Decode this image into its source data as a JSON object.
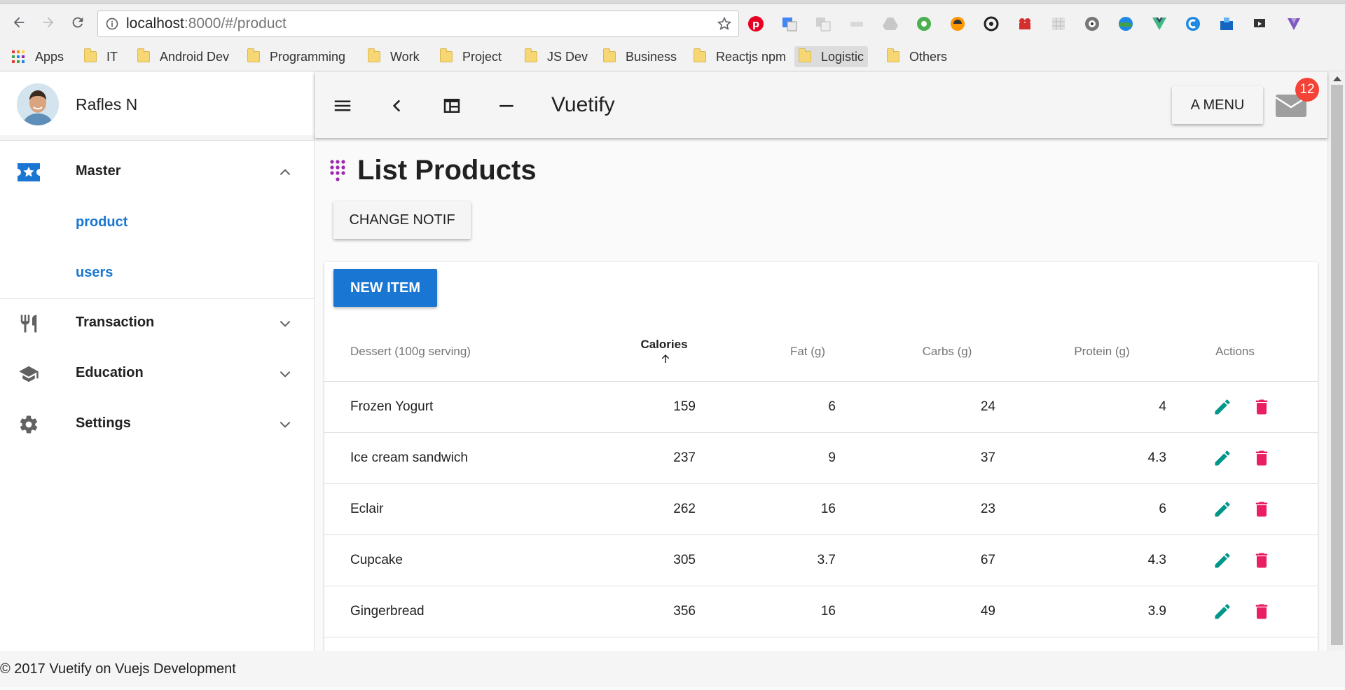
{
  "browser": {
    "url_host": "localhost",
    "url_path": ":8000/#/product",
    "bookmarks": [
      {
        "label": "Apps",
        "type": "apps"
      },
      {
        "label": "IT",
        "type": "folder"
      },
      {
        "label": "Android Dev",
        "type": "folder"
      },
      {
        "label": "Programming",
        "type": "folder"
      },
      {
        "label": "Work",
        "type": "folder"
      },
      {
        "label": "Project",
        "type": "folder"
      },
      {
        "label": "JS Dev",
        "type": "folder"
      },
      {
        "label": "Business",
        "type": "folder"
      },
      {
        "label": "Reactjs npm",
        "type": "folder"
      },
      {
        "label": "Logistic",
        "type": "folder"
      },
      {
        "label": "Others",
        "type": "folder"
      }
    ]
  },
  "drawer": {
    "user_name": "Rafles N",
    "groups": [
      {
        "label": "Master",
        "icon": "ticket-star-icon",
        "expanded": true,
        "children": [
          "product",
          "users"
        ]
      },
      {
        "label": "Transaction",
        "icon": "restaurant-icon",
        "expanded": false
      },
      {
        "label": "Education",
        "icon": "school-icon",
        "expanded": false
      },
      {
        "label": "Settings",
        "icon": "gear-icon",
        "expanded": false
      }
    ]
  },
  "appbar": {
    "title": "Vuetify",
    "menu_label": "A MENU",
    "notification_count": "12"
  },
  "page": {
    "title": "List Products",
    "change_notif_label": "CHANGE NOTIF",
    "new_item_label": "NEW ITEM"
  },
  "table": {
    "headers": [
      "Dessert (100g serving)",
      "Calories",
      "Fat (g)",
      "Carbs (g)",
      "Protein (g)",
      "Actions"
    ],
    "sorted_column": "Calories",
    "rows": [
      {
        "name": "Frozen Yogurt",
        "calories": "159",
        "fat": "6",
        "carbs": "24",
        "protein": "4"
      },
      {
        "name": "Ice cream sandwich",
        "calories": "237",
        "fat": "9",
        "carbs": "37",
        "protein": "4.3"
      },
      {
        "name": "Eclair",
        "calories": "262",
        "fat": "16",
        "carbs": "23",
        "protein": "6"
      },
      {
        "name": "Cupcake",
        "calories": "305",
        "fat": "3.7",
        "carbs": "67",
        "protein": "4.3"
      },
      {
        "name": "Gingerbread",
        "calories": "356",
        "fat": "16",
        "carbs": "49",
        "protein": "3.9"
      }
    ]
  },
  "footer": {
    "text": "© 2017 Vuetify on Vuejs Development"
  },
  "colors": {
    "primary": "#1976d2",
    "edit": "#009688",
    "delete": "#e91e63",
    "badge": "#f44336",
    "icon_purple": "#9c27b0"
  }
}
